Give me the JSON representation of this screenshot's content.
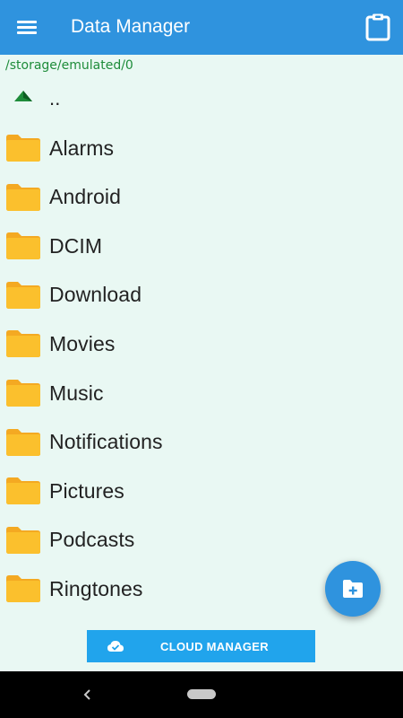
{
  "app": {
    "title": "Data Manager"
  },
  "path": "/storage/emulated/0",
  "up_entry": {
    "label": ".."
  },
  "folders": [
    {
      "label": "Alarms"
    },
    {
      "label": "Android"
    },
    {
      "label": "DCIM"
    },
    {
      "label": "Download"
    },
    {
      "label": "Movies"
    },
    {
      "label": "Music"
    },
    {
      "label": "Notifications"
    },
    {
      "label": "Pictures"
    },
    {
      "label": "Podcasts"
    },
    {
      "label": "Ringtones"
    }
  ],
  "cloud_button": {
    "label": "CLOUD MANAGER"
  },
  "colors": {
    "appbar": "#2f93de",
    "background": "#e9f8f3",
    "path_text": "#1e8c3a",
    "folder": "#fbc02d",
    "cloud_button": "#21a4ec"
  },
  "icons": {
    "menu": "hamburger-icon",
    "clipboard": "clipboard-icon",
    "up": "up-arrow-icon",
    "folder": "folder-icon",
    "fab": "new-folder-icon",
    "cloud": "cloud-done-icon"
  }
}
